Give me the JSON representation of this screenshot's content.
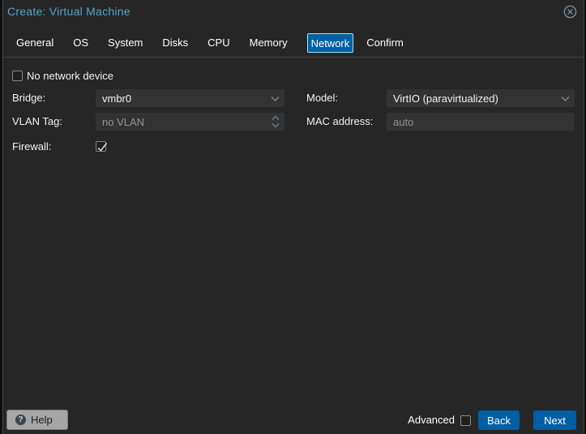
{
  "window": {
    "title": "Create: Virtual Machine"
  },
  "tabs": [
    {
      "label": "General",
      "active": false
    },
    {
      "label": "OS",
      "active": false
    },
    {
      "label": "System",
      "active": false
    },
    {
      "label": "Disks",
      "active": false
    },
    {
      "label": "CPU",
      "active": false
    },
    {
      "label": "Memory",
      "active": false
    },
    {
      "label": "Network",
      "active": true
    },
    {
      "label": "Confirm",
      "active": false
    }
  ],
  "form": {
    "no_network_device": {
      "label": "No network device",
      "checked": false
    },
    "bridge": {
      "label": "Bridge:",
      "value": "vmbr0"
    },
    "vlan": {
      "label": "VLAN Tag:",
      "placeholder": "no VLAN",
      "disabled": true
    },
    "firewall": {
      "label": "Firewall:",
      "checked": true
    },
    "model": {
      "label": "Model:",
      "value": "VirtIO (paravirtualized)"
    },
    "mac": {
      "label": "MAC address:",
      "placeholder": "auto"
    }
  },
  "footer": {
    "help_label": "Help",
    "advanced_label": "Advanced",
    "advanced_checked": false,
    "back_label": "Back",
    "next_label": "Next"
  },
  "colors": {
    "background": "#262626",
    "title_blue": "#4aa4d9",
    "active_tab_bg": "#0061a3",
    "active_tab_border": "#98d8f8",
    "tab_underline": "#424242",
    "field_bg": "#333333",
    "button_blue": "#005fa4",
    "help_bg": "#a6a6a6",
    "dim_text": "#8c8c8c"
  }
}
